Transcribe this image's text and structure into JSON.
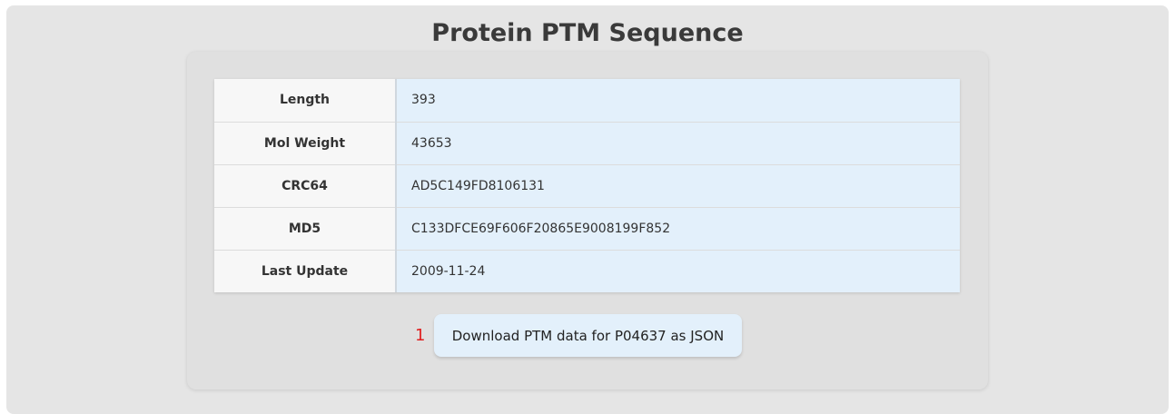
{
  "page": {
    "title": "Protein PTM Sequence"
  },
  "table": {
    "rows": [
      {
        "label": "Length",
        "value": "393"
      },
      {
        "label": "Mol Weight",
        "value": "43653"
      },
      {
        "label": "CRC64",
        "value": "AD5C149FD8106131"
      },
      {
        "label": "MD5",
        "value": "C133DFCE69F606F20865E9008199F852"
      },
      {
        "label": "Last Update",
        "value": "2009-11-24"
      }
    ]
  },
  "actions": {
    "row_number": "1",
    "download_label": "Download PTM data for P04637 as JSON"
  },
  "colors": {
    "panel_background": "#e5e5e5",
    "value_cell_background": "#e3f0fb",
    "label_cell_background": "#f7f7f7",
    "row_number_color": "#e02020"
  }
}
